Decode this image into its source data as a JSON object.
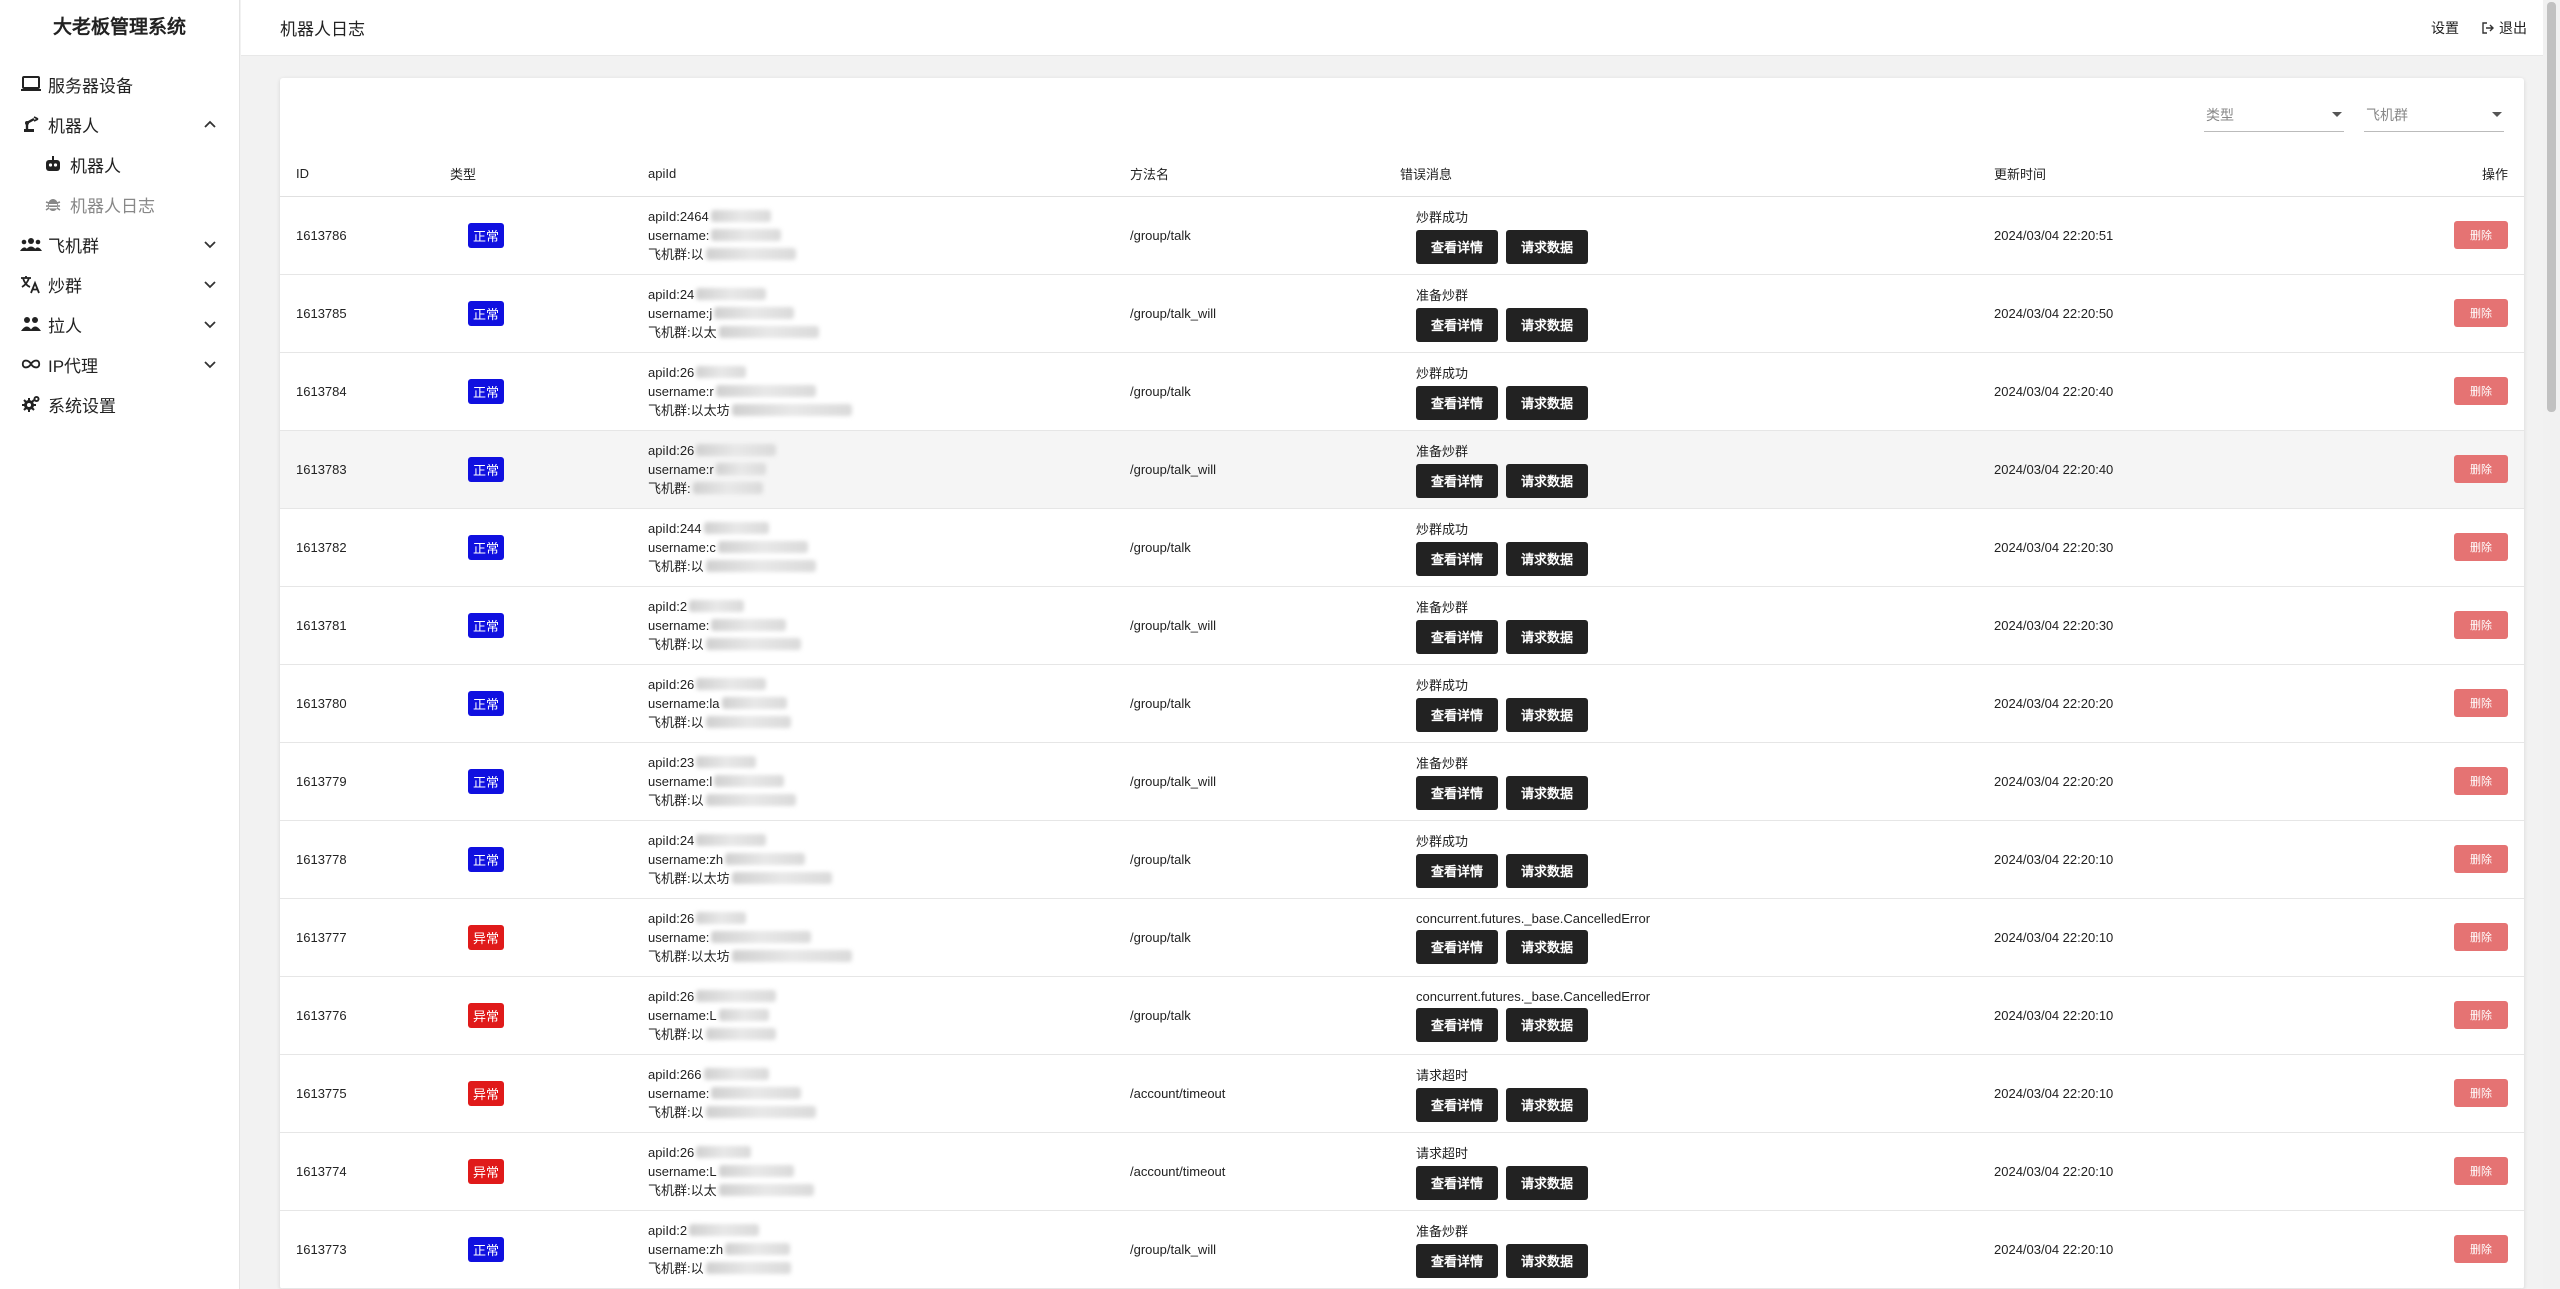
{
  "app": {
    "title": "大老板管理系统"
  },
  "sidebar": {
    "items": [
      {
        "label": "服务器设备",
        "icon": "laptop-icon"
      },
      {
        "label": "机器人",
        "icon": "robot-arm-icon",
        "expanded": true
      },
      {
        "label": "机器人",
        "icon": "robot-icon",
        "sub": true
      },
      {
        "label": "机器人日志",
        "icon": "bug-icon",
        "sub": true,
        "active": true
      },
      {
        "label": "飞机群",
        "icon": "group-icon"
      },
      {
        "label": "炒群",
        "icon": "translate-icon"
      },
      {
        "label": "拉人",
        "icon": "people-icon"
      },
      {
        "label": "IP代理",
        "icon": "infinity-icon"
      },
      {
        "label": "系统设置",
        "icon": "gear-icon"
      }
    ]
  },
  "header": {
    "title": "机器人日志",
    "settings_label": "设置",
    "logout_label": "退出"
  },
  "filters": {
    "type_placeholder": "类型",
    "group_placeholder": "飞机群"
  },
  "table": {
    "columns": [
      "ID",
      "类型",
      "apiId",
      "方法名",
      "错误消息",
      "更新时间",
      "操作"
    ],
    "api_prefixes": {
      "api": "apiId: ",
      "user": "username: ",
      "group": "飞机群: "
    },
    "detail_label": "查看详情",
    "request_label": "请求数据",
    "delete_label": "删除",
    "rows": [
      {
        "id": "1613786",
        "type": "正常",
        "status": "ok",
        "api": "2464",
        "user": "",
        "group": "以",
        "method": "/group/talk",
        "error": "炒群成功",
        "time": "2024/03/04 22:20:51"
      },
      {
        "id": "1613785",
        "type": "正常",
        "status": "ok",
        "api": "24",
        "user": "j",
        "group": "以太",
        "method": "/group/talk_will",
        "error": "准备炒群",
        "time": "2024/03/04 22:20:50"
      },
      {
        "id": "1613784",
        "type": "正常",
        "status": "ok",
        "api": "26",
        "user": "r",
        "group": "以太坊",
        "method": "/group/talk",
        "error": "炒群成功",
        "time": "2024/03/04 22:20:40"
      },
      {
        "id": "1613783",
        "type": "正常",
        "status": "ok",
        "api": "26",
        "user": "r",
        "group": "",
        "method": "/group/talk_will",
        "error": "准备炒群",
        "time": "2024/03/04 22:20:40"
      },
      {
        "id": "1613782",
        "type": "正常",
        "status": "ok",
        "api": "244",
        "user": "c",
        "group": "以",
        "method": "/group/talk",
        "error": "炒群成功",
        "time": "2024/03/04 22:20:30"
      },
      {
        "id": "1613781",
        "type": "正常",
        "status": "ok",
        "api": "2",
        "user": "",
        "group": "以",
        "method": "/group/talk_will",
        "error": "准备炒群",
        "time": "2024/03/04 22:20:30"
      },
      {
        "id": "1613780",
        "type": "正常",
        "status": "ok",
        "api": "26",
        "user": "la",
        "group": "以",
        "method": "/group/talk",
        "error": "炒群成功",
        "time": "2024/03/04 22:20:20"
      },
      {
        "id": "1613779",
        "type": "正常",
        "status": "ok",
        "api": "23",
        "user": "l",
        "group": "以",
        "method": "/group/talk_will",
        "error": "准备炒群",
        "time": "2024/03/04 22:20:20"
      },
      {
        "id": "1613778",
        "type": "正常",
        "status": "ok",
        "api": "24",
        "user": "zh",
        "group": "以太坊",
        "method": "/group/talk",
        "error": "炒群成功",
        "time": "2024/03/04 22:20:10"
      },
      {
        "id": "1613777",
        "type": "异常",
        "status": "err",
        "api": "26",
        "user": "",
        "group": "以太坊",
        "method": "/group/talk",
        "error": "concurrent.futures._base.CancelledError",
        "time": "2024/03/04 22:20:10"
      },
      {
        "id": "1613776",
        "type": "异常",
        "status": "err",
        "api": "26",
        "user": "L",
        "group": "以",
        "method": "/group/talk",
        "error": "concurrent.futures._base.CancelledError",
        "time": "2024/03/04 22:20:10"
      },
      {
        "id": "1613775",
        "type": "异常",
        "status": "err",
        "api": "266",
        "user": "",
        "group": "以",
        "method": "/account/timeout",
        "error": "请求超时",
        "time": "2024/03/04 22:20:10"
      },
      {
        "id": "1613774",
        "type": "异常",
        "status": "err",
        "api": "26",
        "user": "L",
        "group": "以太",
        "method": "/account/timeout",
        "error": "请求超时",
        "time": "2024/03/04 22:20:10"
      },
      {
        "id": "1613773",
        "type": "正常",
        "status": "ok",
        "api": "2",
        "user": "zh",
        "group": "以",
        "method": "/group/talk_will",
        "error": "准备炒群",
        "time": "2024/03/04 22:20:10"
      }
    ]
  }
}
